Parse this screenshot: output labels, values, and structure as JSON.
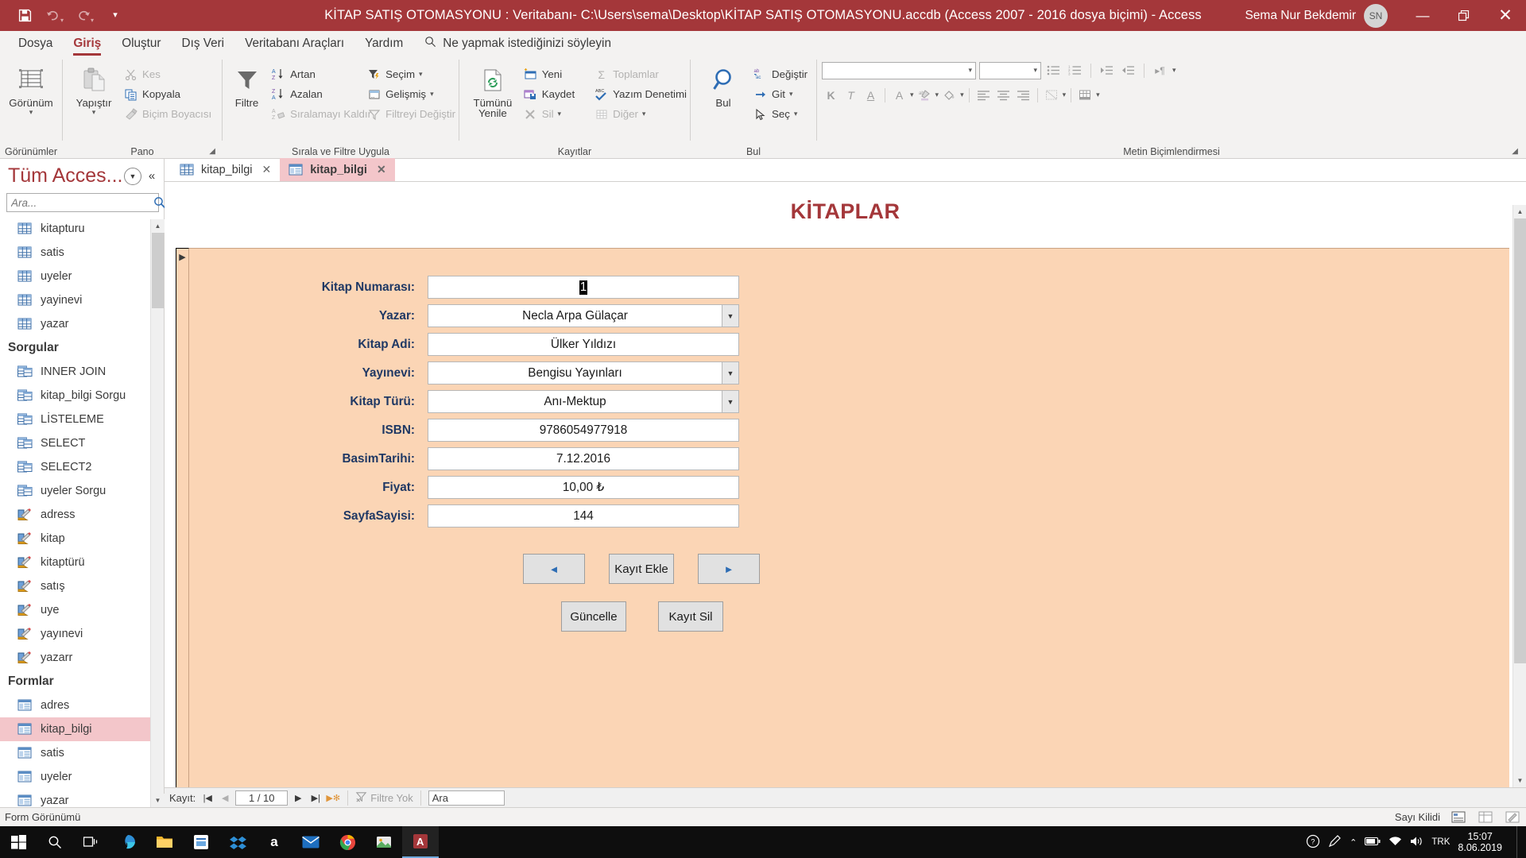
{
  "titlebar": {
    "title": "KİTAP SATIŞ OTOMASYONU : Veritabanı- C:\\Users\\sema\\Desktop\\KİTAP SATIŞ OTOMASYONU.accdb (Access 2007 - 2016 dosya biçimi)  -  Access",
    "account_name": "Sema Nur Bekdemir",
    "account_initials": "SN",
    "qat": [
      {
        "name": "save-icon",
        "glyph": "ὋE"
      },
      {
        "name": "undo-icon",
        "glyph": "↶"
      },
      {
        "name": "redo-icon",
        "glyph": "↷"
      },
      {
        "name": "customize-qat-icon",
        "glyph": "⌄"
      }
    ],
    "window_controls": {
      "minimize": "—",
      "restore": "❐",
      "close": "✕"
    },
    "accent": "#A4373A"
  },
  "menu": {
    "tabs": [
      {
        "label": "Dosya",
        "active": false
      },
      {
        "label": "Giriş",
        "active": true
      },
      {
        "label": "Oluştur",
        "active": false
      },
      {
        "label": "Dış Veri",
        "active": false
      },
      {
        "label": "Veritabanı Araçları",
        "active": false
      },
      {
        "label": "Yardım",
        "active": false
      }
    ],
    "tellme": "Ne yapmak istediğinizi söyleyin"
  },
  "ribbon": {
    "groups": [
      {
        "label": "Görünümler",
        "big": {
          "label": "Görünüm",
          "icon": "view-datasheet-icon"
        },
        "has_launcher": false
      },
      {
        "label": "Pano",
        "big": {
          "label": "Yapıştır",
          "icon": "paste-icon"
        },
        "items": [
          {
            "label": "Kes",
            "icon": "scissors-icon",
            "disabled": true
          },
          {
            "label": "Kopyala",
            "icon": "copy-icon",
            "disabled": false
          },
          {
            "label": "Biçim Boyacısı",
            "icon": "format-painter-icon",
            "disabled": true
          }
        ],
        "has_launcher": true
      },
      {
        "label": "Sırala ve Filtre Uygula",
        "big": {
          "label": "Filtre",
          "icon": "funnel-icon"
        },
        "items": [
          {
            "label": "Artan",
            "icon": "sort-ascending-icon",
            "disabled": false
          },
          {
            "label": "Azalan",
            "icon": "sort-descending-icon",
            "disabled": false
          },
          {
            "label": "Sıralamayı Kaldır",
            "icon": "clear-sort-icon",
            "disabled": true
          }
        ],
        "items2": [
          {
            "label": "Seçim",
            "icon": "selection-filter-icon",
            "disabled": false,
            "dropdown": true
          },
          {
            "label": "Gelişmiş",
            "icon": "advanced-filter-icon",
            "disabled": false,
            "dropdown": true
          },
          {
            "label": "Filtreyi Değiştir",
            "icon": "toggle-filter-icon",
            "disabled": true
          }
        ],
        "has_launcher": false
      },
      {
        "label": "Kayıtlar",
        "big": {
          "label": "Tümünü Yenile",
          "icon": "refresh-all-icon",
          "dropdown": true
        },
        "items": [
          {
            "label": "Yeni",
            "icon": "new-record-icon",
            "disabled": false
          },
          {
            "label": "Kaydet",
            "icon": "save-record-icon",
            "disabled": false
          },
          {
            "label": "Sil",
            "icon": "delete-record-icon",
            "disabled": true,
            "dropdown": true
          }
        ],
        "items2": [
          {
            "label": "Toplamlar",
            "icon": "totals-sigma-icon",
            "disabled": true
          },
          {
            "label": "Yazım Denetimi",
            "icon": "spelling-icon",
            "disabled": false
          },
          {
            "label": "Diğer",
            "icon": "more-grid-icon",
            "disabled": true,
            "dropdown": true
          }
        ],
        "has_launcher": false
      },
      {
        "label": "Bul",
        "big": {
          "label": "Bul",
          "icon": "magnifier-icon"
        },
        "items": [
          {
            "label": "Değiştir",
            "icon": "replace-icon",
            "disabled": false
          },
          {
            "label": "Git",
            "icon": "goto-icon",
            "disabled": false,
            "dropdown": true
          },
          {
            "label": "Seç",
            "icon": "select-cursor-icon",
            "disabled": false,
            "dropdown": true
          }
        ],
        "has_launcher": false
      },
      {
        "label": "Metin Biçimlendirmesi",
        "font_name": "",
        "font_size": "",
        "buttons_row2": [
          "K",
          "T",
          "A"
        ],
        "has_launcher": true
      }
    ]
  },
  "navpane": {
    "title": "Tüm Acces...",
    "search_placeholder": "Ara...",
    "items": [
      {
        "label": "kitapturu",
        "type": "table",
        "selected": false
      },
      {
        "label": "satis",
        "type": "table",
        "selected": false
      },
      {
        "label": "uyeler",
        "type": "table",
        "selected": false
      },
      {
        "label": "yayinevi",
        "type": "table",
        "selected": false
      },
      {
        "label": "yazar",
        "type": "table",
        "selected": false
      },
      {
        "label": "Sorgular",
        "type": "group"
      },
      {
        "label": "INNER JOIN",
        "type": "query",
        "selected": false
      },
      {
        "label": "kitap_bilgi Sorgu",
        "type": "query",
        "selected": false
      },
      {
        "label": "LİSTELEME",
        "type": "query",
        "selected": false
      },
      {
        "label": "SELECT",
        "type": "query",
        "selected": false
      },
      {
        "label": "SELECT2",
        "type": "query",
        "selected": false
      },
      {
        "label": "uyeler Sorgu",
        "type": "query",
        "selected": false
      },
      {
        "label": "adress",
        "type": "report",
        "selected": false
      },
      {
        "label": "kitap",
        "type": "report",
        "selected": false
      },
      {
        "label": "kitaptürü",
        "type": "report",
        "selected": false
      },
      {
        "label": "satış",
        "type": "report",
        "selected": false
      },
      {
        "label": "uye",
        "type": "report",
        "selected": false
      },
      {
        "label": "yayınevi",
        "type": "report",
        "selected": false
      },
      {
        "label": "yazarr",
        "type": "report",
        "selected": false
      },
      {
        "label": "Formlar",
        "type": "group"
      },
      {
        "label": "adres",
        "type": "form",
        "selected": false
      },
      {
        "label": "kitap_bilgi",
        "type": "form",
        "selected": true
      },
      {
        "label": "satis",
        "type": "form",
        "selected": false
      },
      {
        "label": "uyeler",
        "type": "form",
        "selected": false
      },
      {
        "label": "yazar",
        "type": "form",
        "selected": false
      }
    ]
  },
  "doctabs": [
    {
      "label": "kitap_bilgi",
      "type": "table",
      "active": false
    },
    {
      "label": "kitap_bilgi",
      "type": "form",
      "active": true
    }
  ],
  "form": {
    "title": "KİTAPLAR",
    "fields": [
      {
        "label": "Kitap Numarası:",
        "value": "1",
        "control": "text",
        "selected": true
      },
      {
        "label": "Yazar:",
        "value": "Necla Arpa Gülaçar",
        "control": "combo"
      },
      {
        "label": "Kitap Adi:",
        "value": "Ülker Yıldızı",
        "control": "text"
      },
      {
        "label": "Yayınevi:",
        "value": "Bengisu Yayınları",
        "control": "combo"
      },
      {
        "label": "Kitap Türü:",
        "value": "Anı-Mektup",
        "control": "combo"
      },
      {
        "label": "ISBN:",
        "value": "9786054977918",
        "control": "text"
      },
      {
        "label": "BasimTarihi:",
        "value": "7.12.2016",
        "control": "text"
      },
      {
        "label": "Fiyat:",
        "value": "10,00 ₺",
        "control": "text"
      },
      {
        "label": "SayfaSayisi:",
        "value": "144",
        "control": "text"
      }
    ],
    "buttons_row1": [
      {
        "name": "previous-record-button",
        "label": "◄",
        "kind": "nav"
      },
      {
        "name": "add-record-button",
        "label": "Kayıt Ekle",
        "kind": "wide"
      },
      {
        "name": "next-record-button",
        "label": "►",
        "kind": "nav"
      }
    ],
    "buttons_row2": [
      {
        "name": "update-button",
        "label": "Güncelle",
        "kind": "wide"
      },
      {
        "name": "delete-record-button",
        "label": "Kayıt Sil",
        "kind": "wide"
      }
    ]
  },
  "recordnav": {
    "label": "Kayıt:",
    "position": "1 / 10",
    "filter_text": "Filtre Yok",
    "search_text": "Ara"
  },
  "statusbar": {
    "left": "Form Görünümü",
    "right": "Sayı Kilidi"
  },
  "taskbar": {
    "icons": [
      {
        "name": "start-windows-icon"
      },
      {
        "name": "search-icon"
      },
      {
        "name": "task-view-icon"
      },
      {
        "name": "edge-browser-icon"
      },
      {
        "name": "file-explorer-icon"
      },
      {
        "name": "microsoft-store-icon"
      },
      {
        "name": "dropbox-icon"
      },
      {
        "name": "amazon-icon"
      },
      {
        "name": "mail-icon"
      },
      {
        "name": "chrome-icon"
      },
      {
        "name": "photos-icon"
      },
      {
        "name": "access-icon",
        "active": true
      }
    ],
    "tray": [
      {
        "name": "help-circle-icon"
      },
      {
        "name": "pen-icon"
      },
      {
        "name": "show-hidden-icons-icon"
      },
      {
        "name": "battery-icon"
      },
      {
        "name": "network-icon"
      },
      {
        "name": "volume-icon"
      },
      {
        "name": "language-icon",
        "label": "TRK"
      }
    ],
    "clock_time": "15:07",
    "clock_date": "8.06.2019"
  }
}
